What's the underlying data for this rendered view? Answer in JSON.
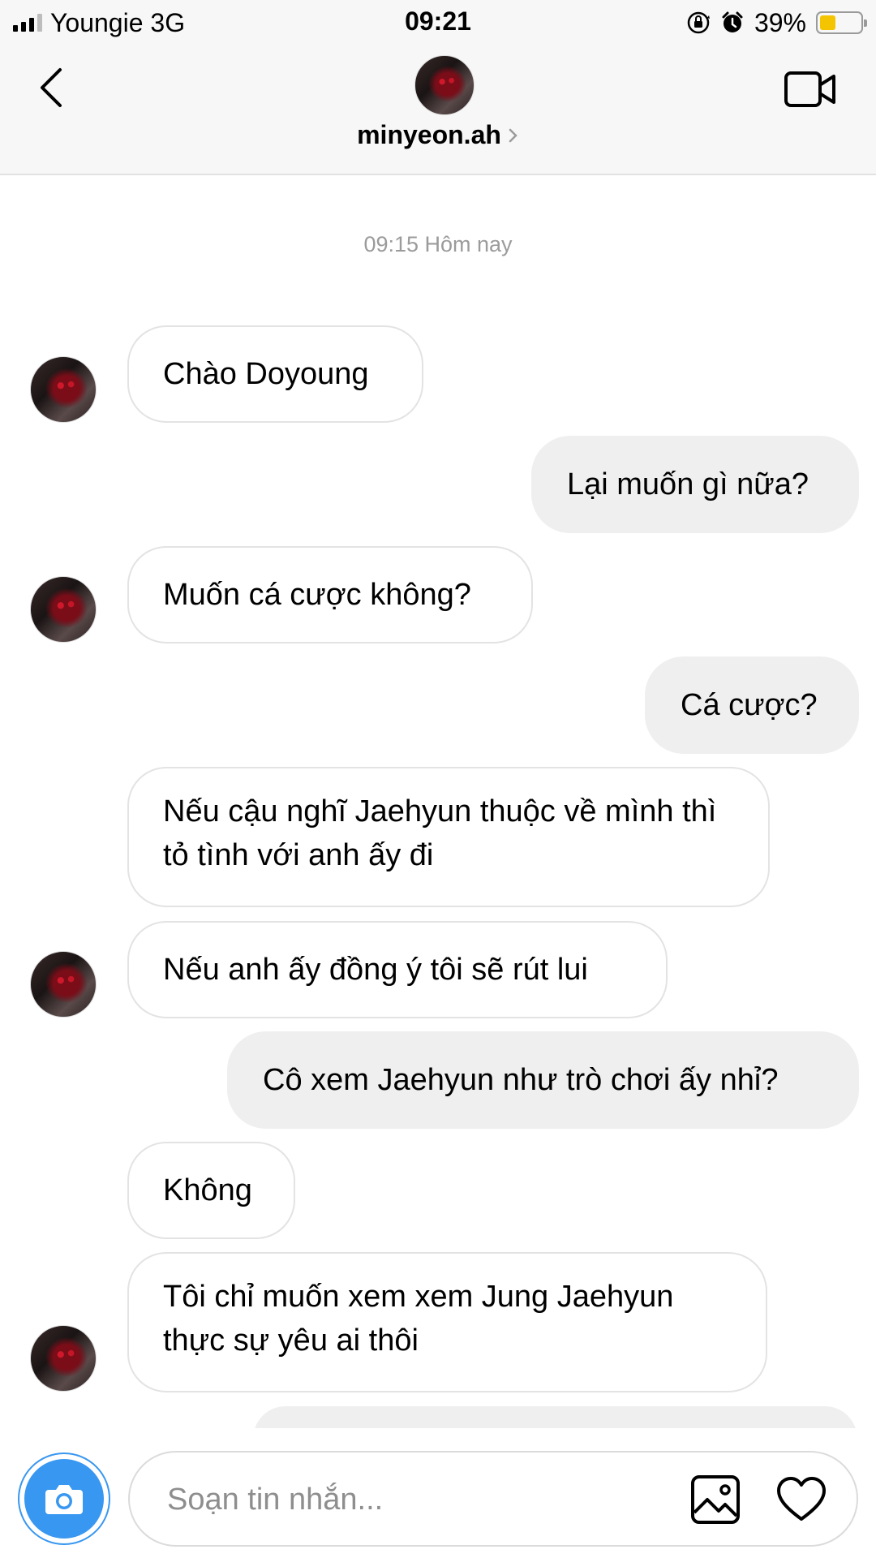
{
  "status_bar": {
    "carrier": "Youngie 3G",
    "time": "09:21",
    "battery_percent": "39%",
    "battery_level": 0.39,
    "icons": [
      "signal-icon",
      "orientation-lock-icon",
      "alarm-icon",
      "battery-icon"
    ],
    "battery_color": "#f5c400"
  },
  "header": {
    "username": "minyeon.ah",
    "icons": [
      "back-arrow-icon",
      "video-call-icon",
      "chevron-right-icon"
    ]
  },
  "conversation": {
    "timestamp": "09:15 Hôm nay",
    "messages": [
      {
        "direction": "incoming",
        "text": "Chào Doyoung"
      },
      {
        "direction": "outgoing",
        "text": "Lại muốn gì nữa?"
      },
      {
        "direction": "incoming",
        "text": "Muốn cá cược không?"
      },
      {
        "direction": "outgoing",
        "text": "Cá cược?"
      },
      {
        "direction": "incoming",
        "text": "Nếu cậu nghĩ Jaehyun thuộc về mình thì tỏ tình với anh ấy đi"
      },
      {
        "direction": "incoming",
        "text": "Nếu anh ấy đồng ý tôi sẽ rút lui"
      },
      {
        "direction": "outgoing",
        "text": "Cô xem Jaehyun như trò chơi ấy nhỉ?"
      },
      {
        "direction": "incoming",
        "text": "Không"
      },
      {
        "direction": "incoming",
        "text": "Tôi chỉ muốn xem xem Jung Jaehyun thực sự yêu ai thôi"
      }
    ]
  },
  "composer": {
    "placeholder": "Soạn tin nhắn...",
    "value": "",
    "accent_color": "#3897f0",
    "icons": [
      "camera-icon",
      "gallery-icon",
      "heart-icon"
    ]
  },
  "colors": {
    "incoming_bubble": "#ffffff",
    "outgoing_bubble": "#efefef",
    "header_bg": "#f7f7f7"
  }
}
